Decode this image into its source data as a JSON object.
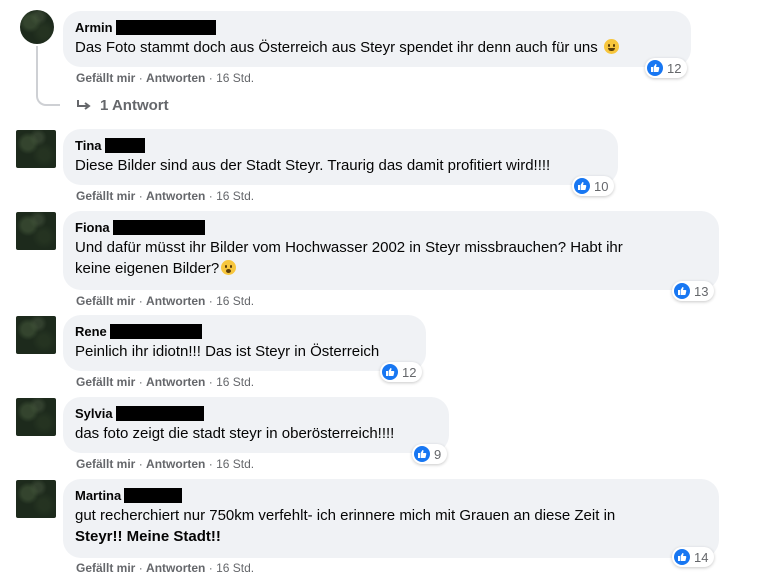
{
  "action_like": "Gefällt mir",
  "action_reply": "Antworten",
  "separator": "·",
  "comments": [
    {
      "name": "Armin",
      "text": "Das Foto stammt doch aus Österreich aus Steyr spendet ihr denn auch für uns",
      "time": "16 Std.",
      "likes": "12"
    },
    {
      "name": "Tina",
      "text": "Diese Bilder sind aus der Stadt Steyr. Traurig das damit profitiert wird!!!!",
      "time": "16 Std.",
      "likes": "10"
    },
    {
      "name": "Fiona",
      "text_line1": "Und dafür müsst ihr Bilder vom Hochwasser 2002 in Steyr missbrauchen? Habt ihr",
      "text_line2": "keine eigenen Bilder?",
      "time": "16 Std.",
      "likes": "13"
    },
    {
      "name": "Rene",
      "text": "Peinlich ihr idiotn!!! Das ist Steyr in Österreich",
      "time": "16 Std.",
      "likes": "12"
    },
    {
      "name": "Sylvia",
      "text": "das foto zeigt die stadt steyr in oberösterreich!!!!",
      "time": "16 Std.",
      "likes": "9"
    },
    {
      "name": "Martina",
      "text_line1": "gut recherchiert nur 750km verfehlt- ich erinnere mich mit Grauen an diese Zeit in",
      "text_line2": "Steyr!! Meine Stadt!!",
      "time": "16 Std.",
      "likes": "14"
    }
  ],
  "reply_link": "1 Antwort",
  "colors": {
    "bubble": "#f0f2f5",
    "like_blue": "#1877f2",
    "meta_gray": "#65676b"
  },
  "icons": {
    "like": "like-thumb-icon",
    "reply_arrow": "reply-arrow-icon",
    "smile": "smile-emoji-icon",
    "worried": "worried-emoji-icon"
  }
}
